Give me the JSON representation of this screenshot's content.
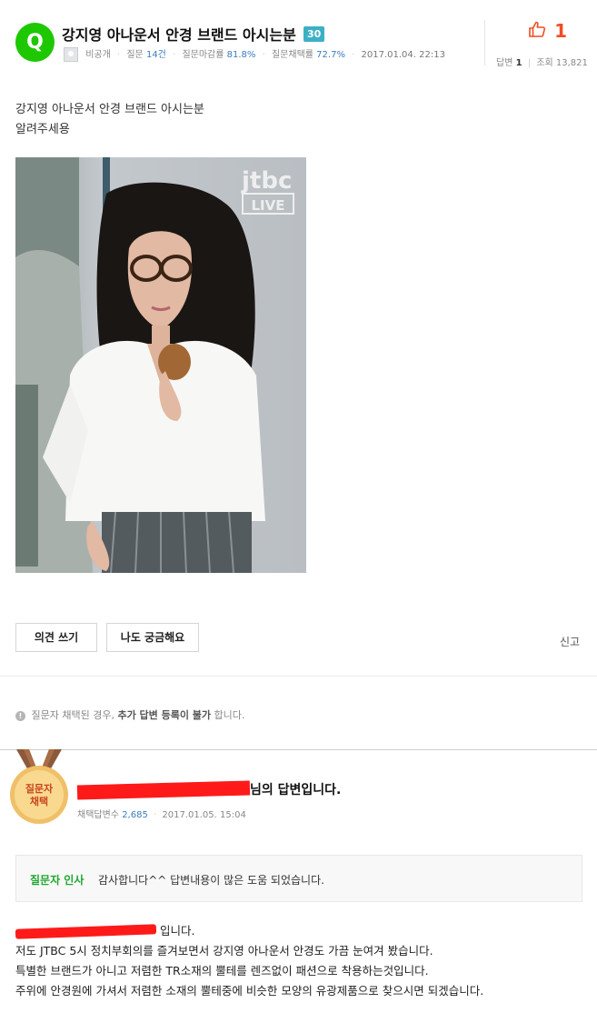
{
  "question": {
    "badge_letter": "Q",
    "title": "강지영 아나운서 안경 브랜드 아시는분",
    "points": "30",
    "author": "비공개",
    "question_label": "질문",
    "question_count": "14건",
    "close_rate_label": "질문마감률",
    "close_rate": "81.8%",
    "adopt_rate_label": "질문채택률",
    "adopt_rate": "72.7%",
    "date": "2017.01.04. 22:13",
    "body_line1": "강지영 아나운서 안경 브랜드 아시는분",
    "body_line2": "알려주세용",
    "image_watermark": "jtbc",
    "image_watermark_sub": "LIVE"
  },
  "stats": {
    "likes": "1",
    "answers_label": "답변",
    "answers": "1",
    "views_label": "조회",
    "views": "13,821"
  },
  "actions": {
    "opinion_label": "의견 쓰기",
    "curious_label": "나도 궁금해요",
    "report_label": "신고"
  },
  "notice": {
    "prefix": "질문자 채택된 경우, ",
    "bold": "추가 답변 등록이 불가",
    "suffix": "합니다."
  },
  "answer": {
    "medal_line1": "질문자",
    "medal_line2": "채택",
    "title_suffix": "님의 답변입니다.",
    "adopted_label": "채택답변수",
    "adopted_count": "2,685",
    "date": "2017.01.05. 15:04",
    "greet_label": "질문자 인사",
    "greet_text": "감사합니다^^ 답변내용이 많은 도움 되었습니다.",
    "line1_suffix": "입니다.",
    "line2": "저도 JTBC 5시 정치부회의를 즐겨보면서 강지영 아나운서 안경도 가끔 눈여겨 봤습니다.",
    "line3": "특별한 브랜드가 아니고 저렴한 TR소재의 뿔테를 렌즈없이 패션으로 착용하는것입니다.",
    "line4": "주위에 안경원에 가셔서 저렴한 소재의 뿔테중에 비슷한 모양의 유광제품으로 찾으시면 되겠습니다."
  },
  "colors": {
    "brand_green": "#1ec800",
    "point_badge": "#3cb1c5",
    "like_red": "#ef4e24",
    "link_blue": "#3b7bbf",
    "greet_green": "#1fa82e"
  }
}
